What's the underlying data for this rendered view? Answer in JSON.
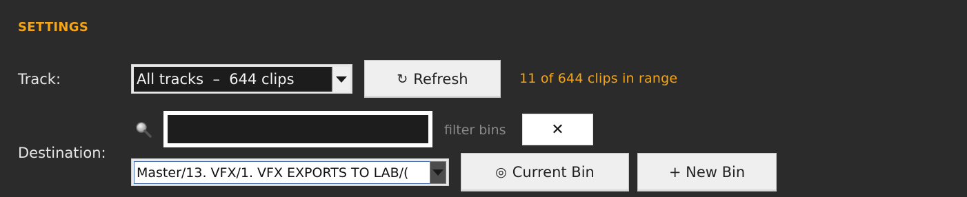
{
  "settings": {
    "title": "SETTINGS"
  },
  "track": {
    "label": "Track:",
    "selected": "All tracks  –  644 clips",
    "refresh_icon": "refresh-icon",
    "refresh_glyph": "↻",
    "refresh_label": "Refresh",
    "status": "11 of 644 clips in range"
  },
  "destination": {
    "label": "Destination:",
    "search_icon": "search-icon",
    "filter_value": "",
    "filter_hint": "filter bins",
    "clear_glyph": "✕",
    "selected": "Master/13. VFX/1. VFX EXPORTS TO LAB/(",
    "current_bin_glyph": "◎",
    "current_bin_label": "Current Bin",
    "new_bin_label": "+ New Bin"
  },
  "colors": {
    "background": "#2b2b2b",
    "accent": "#f5a516",
    "text": "#e6e6e6",
    "muted": "#8a8a8a"
  }
}
